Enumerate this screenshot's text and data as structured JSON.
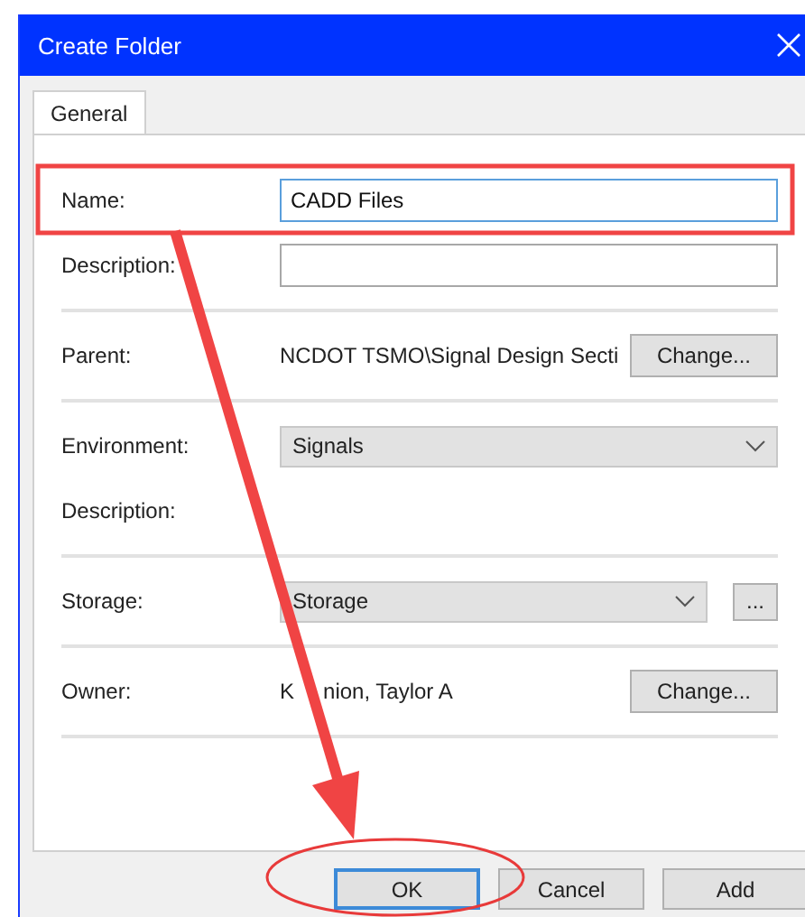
{
  "window": {
    "title": "Create Folder"
  },
  "tabs": [
    {
      "label": "General",
      "selected": true
    }
  ],
  "sections": [
    [
      {
        "kind": "text",
        "label": "Name:",
        "value": "CADD Files",
        "focused": true
      },
      {
        "kind": "text",
        "label": "Description:",
        "focused": false
      }
    ],
    [
      {
        "kind": "value",
        "label": "Parent:",
        "value": "NCDOT TSMO\\Signal Design Secti",
        "button": "Change..."
      }
    ],
    [
      {
        "kind": "select",
        "label": "Environment:",
        "value": "Signals"
      },
      {
        "kind": "label",
        "label": "Description:"
      }
    ],
    [
      {
        "kind": "select",
        "label": "Storage:",
        "value": "Storage",
        "button": "..."
      }
    ],
    [
      {
        "kind": "value",
        "label": "Owner:",
        "value": [
          "K",
          "nion, Taylor A"
        ],
        "button": "Change..."
      }
    ]
  ],
  "buttons": [
    {
      "label": "OK",
      "default": true
    },
    {
      "label": "Cancel",
      "default": false
    },
    {
      "label": "Add",
      "default": false
    }
  ]
}
